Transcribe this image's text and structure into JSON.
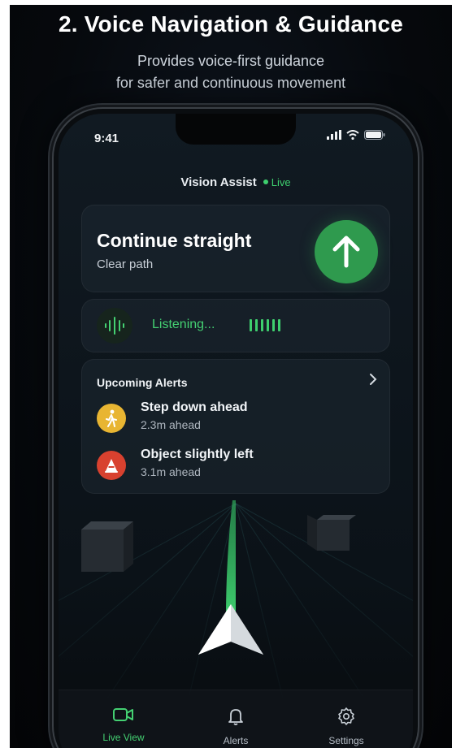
{
  "headline": "2. Voice Navigation & Guidance",
  "subline": [
    "Provides voice-first guidance",
    "for safer and continuous movement"
  ],
  "status_bar": {
    "time": "9:41"
  },
  "app": {
    "title": "Vision Assist",
    "live_label": "Live"
  },
  "direction": {
    "instruction": "Continue straight",
    "detail": "Clear path",
    "arrow_icon": "arrow-up-icon"
  },
  "listening": {
    "label": "Listening..."
  },
  "alerts": {
    "heading": "Upcoming Alerts",
    "items": [
      {
        "title": "Step down ahead",
        "distance": "2.3m ahead",
        "icon": "pedestrian-icon",
        "color": "#e8b532"
      },
      {
        "title": "Object slightly left",
        "distance": "3.1m ahead",
        "icon": "warning-cone-icon",
        "color": "#d8412f"
      }
    ]
  },
  "nav": {
    "items": [
      {
        "label": "Live View",
        "icon": "video-camera-icon",
        "active": true
      },
      {
        "label": "Alerts",
        "icon": "bell-icon",
        "active": false
      },
      {
        "label": "Settings",
        "icon": "gear-icon",
        "active": false
      }
    ]
  },
  "colors": {
    "accent": "#3ecf6e",
    "card": "#1e2832",
    "background": "#06090d"
  }
}
